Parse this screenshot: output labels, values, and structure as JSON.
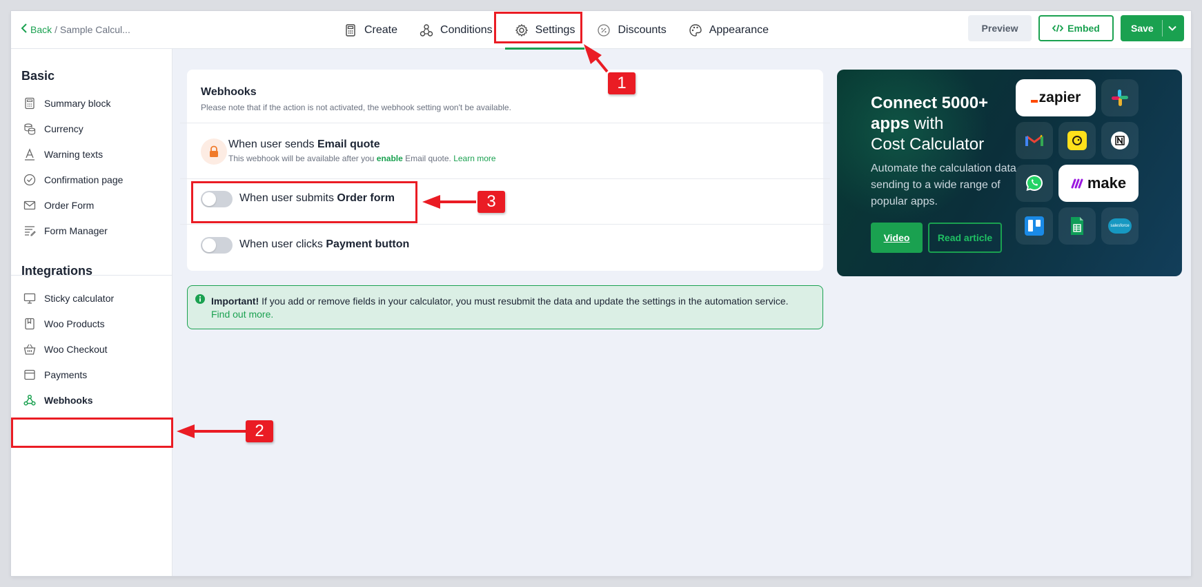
{
  "header": {
    "back_label": "Back",
    "crumb": "/ Sample Calcul...",
    "tabs": [
      {
        "label": "Create",
        "icon": "calculator-icon"
      },
      {
        "label": "Conditions",
        "icon": "nodes-icon"
      },
      {
        "label": "Settings",
        "icon": "gear-icon",
        "active": true
      },
      {
        "label": "Discounts",
        "icon": "percent-icon"
      },
      {
        "label": "Appearance",
        "icon": "palette-icon"
      }
    ],
    "preview_label": "Preview",
    "embed_label": "Embed",
    "save_label": "Save"
  },
  "sidebar": {
    "basic_heading": "Basic",
    "basic_items": [
      {
        "label": "Summary block",
        "icon": "calculator-icon"
      },
      {
        "label": "Currency",
        "icon": "coins-icon"
      },
      {
        "label": "Warning texts",
        "icon": "text-icon"
      },
      {
        "label": "Confirmation page",
        "icon": "check-circle-icon"
      },
      {
        "label": "Order Form",
        "icon": "envelope-icon"
      },
      {
        "label": "Form Manager",
        "icon": "form-list-icon"
      }
    ],
    "integrations_heading": "Integrations",
    "integration_items": [
      {
        "label": "Sticky calculator",
        "icon": "monitor-icon"
      },
      {
        "label": "Woo Products",
        "icon": "bookmark-icon"
      },
      {
        "label": "Woo Checkout",
        "icon": "basket-icon"
      },
      {
        "label": "Payments",
        "icon": "card-icon"
      },
      {
        "label": "Webhooks",
        "icon": "webhook-icon",
        "active": true
      }
    ]
  },
  "webhooks": {
    "title": "Webhooks",
    "subtitle": "Please note that if the action is not activated, the webhook setting won't be available.",
    "email": {
      "prefix": "When user sends",
      "bold": "Email quote",
      "note_prefix": "This webhook will be available after you",
      "note_enable": "enable",
      "note_suffix": "Email quote.",
      "learn_more": "Learn more"
    },
    "order": {
      "prefix": "When user submits",
      "bold": "Order form",
      "enabled": false
    },
    "payment": {
      "prefix": "When user clicks",
      "bold": "Payment button",
      "enabled": false
    }
  },
  "info": {
    "bold": "Important!",
    "text": "If you add or remove fields in your calculator, you must resubmit the data and update the settings in the automation service.",
    "link": "Find out more."
  },
  "promo": {
    "title_bold_1": "Connect 5000+",
    "title_bold_2": "apps",
    "title_rest_1": "with",
    "title_rest_2": "Cost Calculator",
    "description": "Automate the calculation data sending to a wide range of popular apps.",
    "video_label": "Video",
    "read_label": "Read article",
    "apps": [
      "zapier",
      "slack",
      "gmail",
      "mailchimp",
      "notion",
      "whatsapp",
      "make",
      "trello",
      "sheets",
      "salesforce"
    ],
    "zapier_word": "zapier",
    "make_word": "make",
    "salesforce_word": "salesforce"
  },
  "annotations": [
    "1",
    "2",
    "3"
  ],
  "colors": {
    "accent": "#1aa150",
    "annotation": "#ea1c24"
  }
}
